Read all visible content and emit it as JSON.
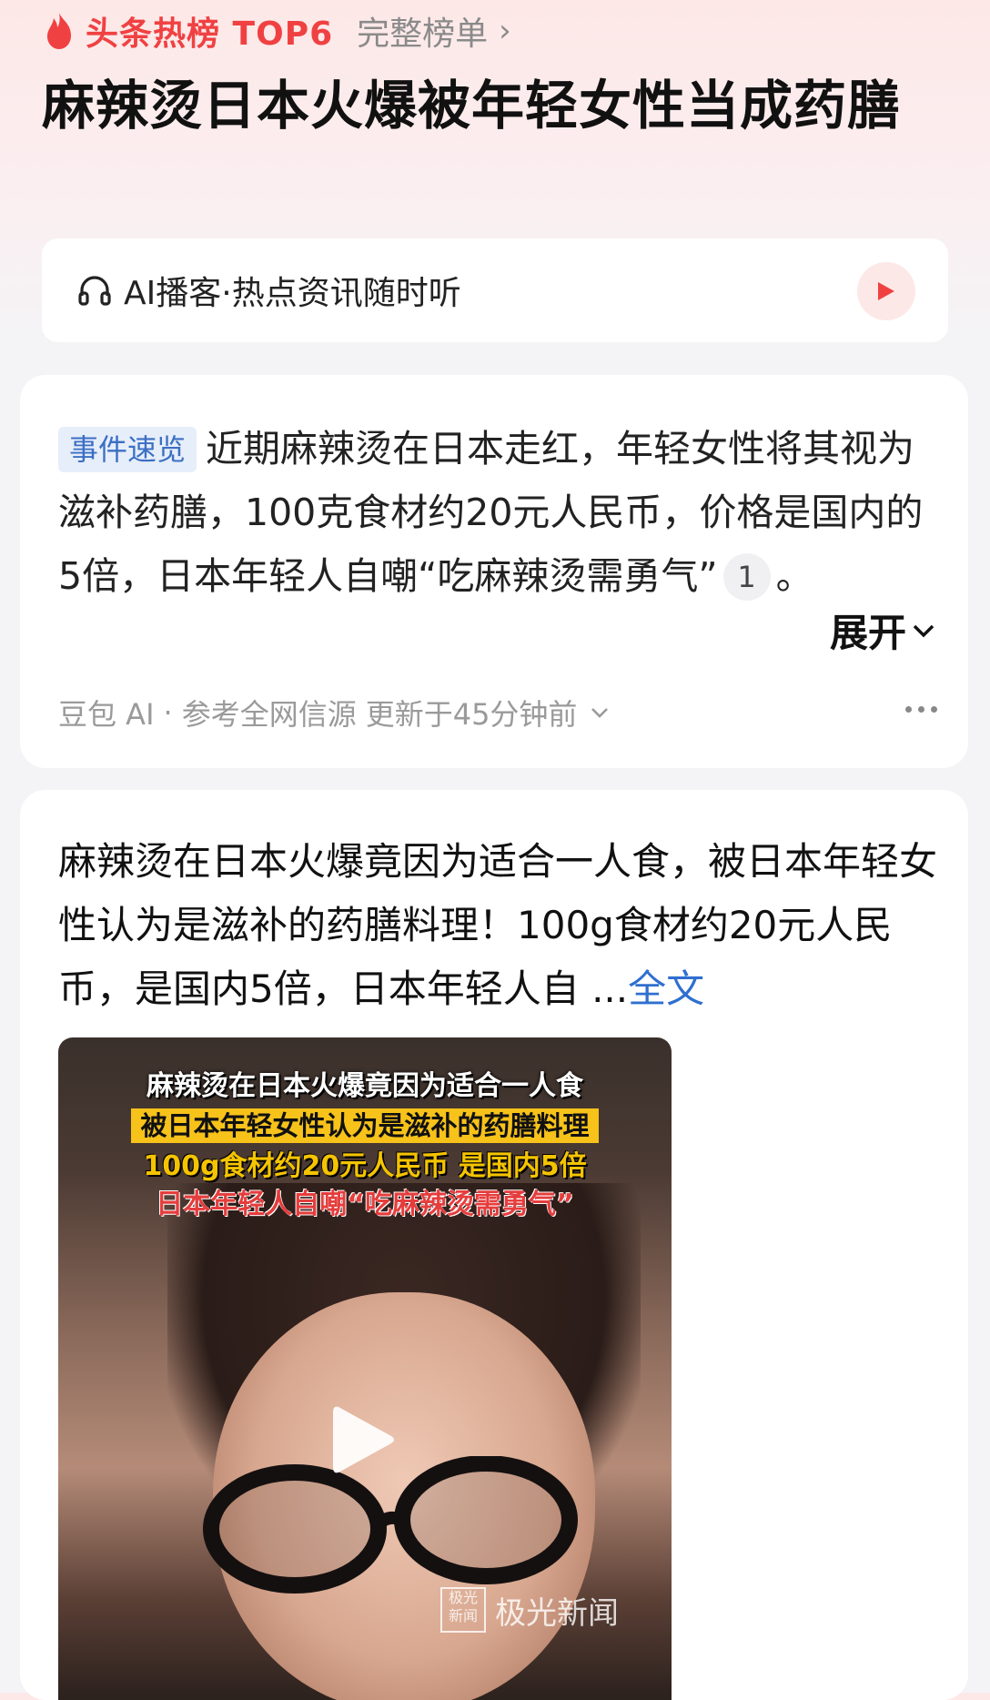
{
  "header": {
    "hot_label": "头条热榜 TOP6",
    "full_list": "完整榜单",
    "title": "麻辣烫日本火爆被年轻女性当成药膳"
  },
  "podcast": {
    "label": "AI播客·热点资讯随时听",
    "play_icon": "play-icon",
    "accent": "#f04142"
  },
  "summary_card": {
    "tag": "事件速览",
    "text_before_ref": "近期麻辣烫在日本走红，年轻女性将其视为滋补药膳，100克食材约20元人民币，价格是国内的5倍，日本年轻人自嘲“吃麻辣烫需勇气”",
    "ref_number": "1",
    "text_after_ref": "。",
    "expand_label": "展开",
    "meta_source": "豆包 AI",
    "meta_ref": "参考全网信源",
    "meta_updated": "更新于45分钟前"
  },
  "post_card": {
    "text": "麻辣烫在日本火爆竟因为适合一人食，被日本年轻女性认为是滋补的药膳料理！100g食材约20元人民币，是国内5倍，日本年轻人自 ...",
    "full_text_link": "全文",
    "video": {
      "caption_1": "麻辣烫在日本火爆竟因为适合一人食",
      "caption_2": "被日本年轻女性认为是滋补的药膳料理",
      "caption_3": "100g食材约20元人民币 是国内5倍",
      "caption_4": "日本年轻人自嘲“吃麻辣烫需勇气”",
      "watermark_box": "极光新闻",
      "watermark_text": "极光新闻"
    }
  }
}
